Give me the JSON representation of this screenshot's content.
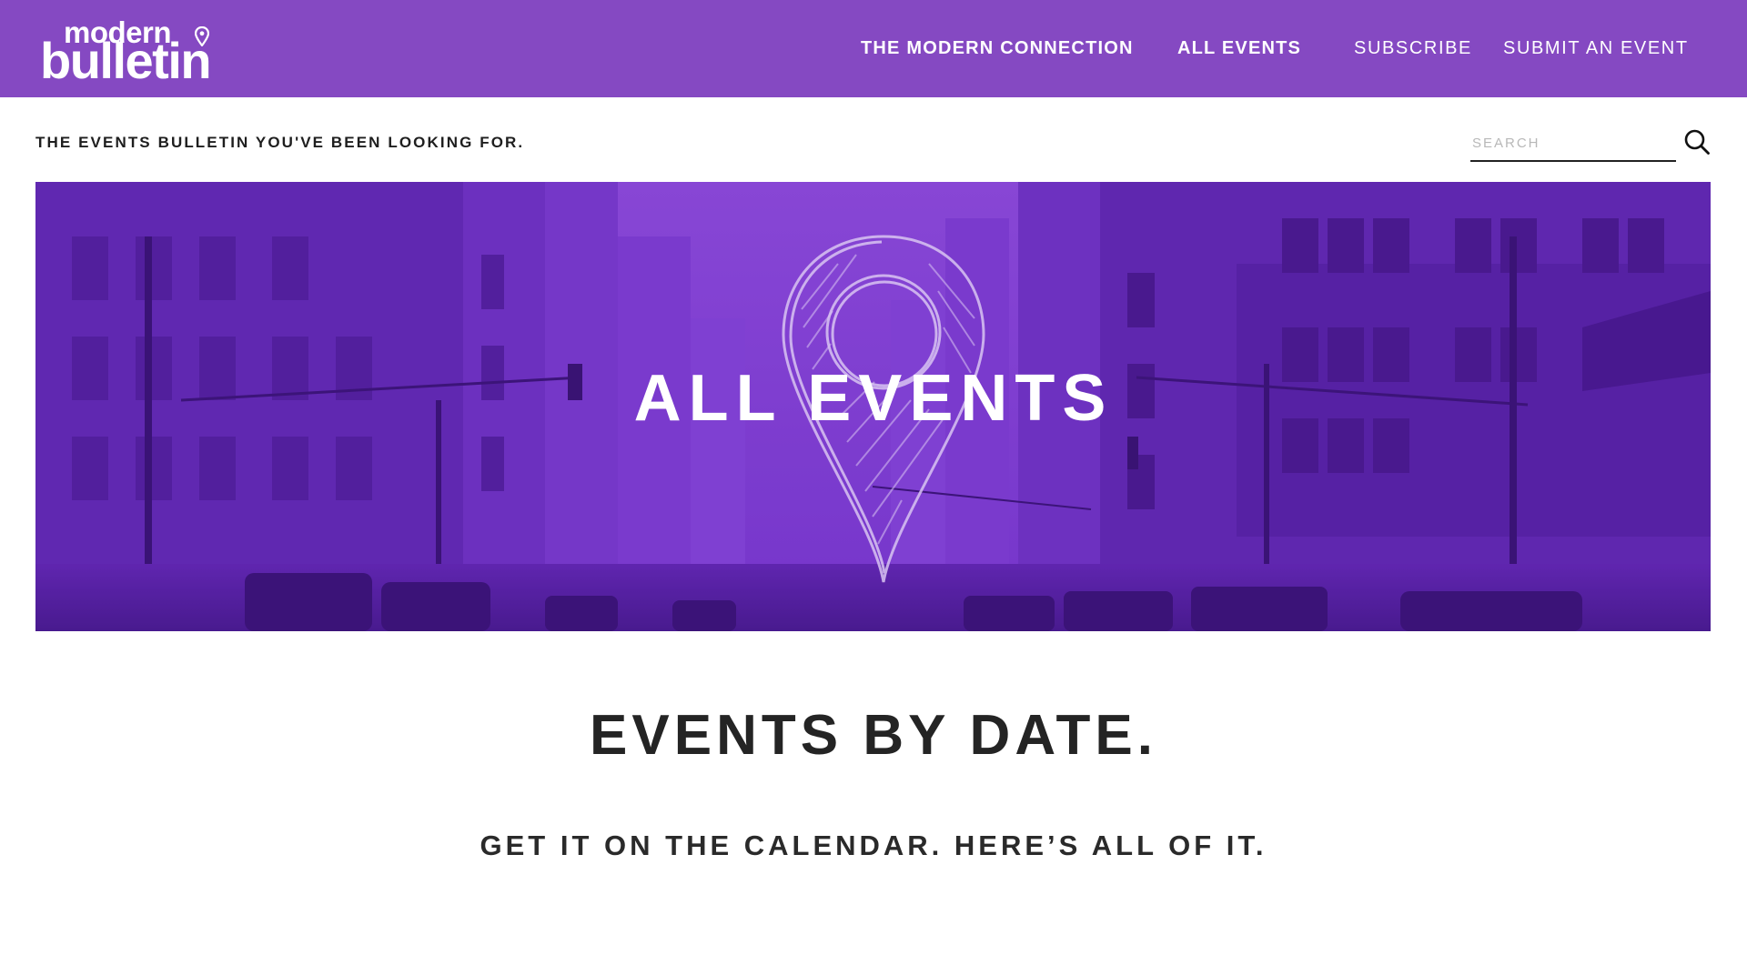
{
  "header": {
    "logo": {
      "top": "modern",
      "bottom": "bulletin"
    },
    "nav": [
      {
        "label": "THE MODERN CONNECTION"
      },
      {
        "label": "ALL EVENTS"
      },
      {
        "label": "SUBSCRIBE"
      },
      {
        "label": "SUBMIT AN EVENT"
      }
    ],
    "brand_color": "#8549c2"
  },
  "subheader": {
    "tagline": "THE EVENTS BULLETIN YOU'VE BEEN LOOKING FOR.",
    "search": {
      "placeholder": "SEARCH",
      "value": "",
      "icon": "search-icon"
    }
  },
  "hero": {
    "title": "ALL EVENTS",
    "overlay_color": "#7a3ad0",
    "icon": "map-pin-icon"
  },
  "main": {
    "heading": "EVENTS BY DATE.",
    "subheading": "GET IT ON THE CALENDAR. HERE’S ALL OF IT."
  }
}
